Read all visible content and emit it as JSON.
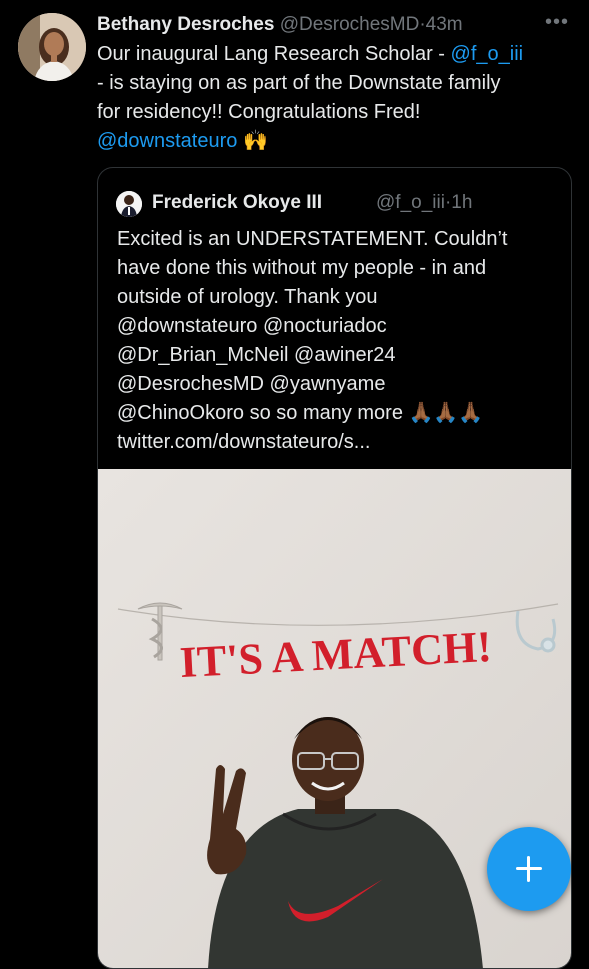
{
  "tweet": {
    "author_name": "Bethany Desroches",
    "author_handle": "@DesrochesMD",
    "separator": "·",
    "time": "43m",
    "more_label": "•••",
    "text_line1_a": "Our inaugural Lang Research Scholar - ",
    "text_line1_mention": "@f_o_iii",
    "text_line2": "- is staying on as part of the Downstate family",
    "text_line3": "for residency!! Congratulations Fred!",
    "text_line4_mention": "@downstateuro",
    "text_line4_emoji": "🙌"
  },
  "quote": {
    "author_name": "Frederick Okoye III",
    "author_handle": "@f_o_iii",
    "separator": "·",
    "time": "1h",
    "lines": [
      "Excited is an UNDERSTATEMENT. Couldn’t",
      "have done this without my people - in and",
      "outside of urology. Thank you",
      "@downstateuro @nocturiadoc",
      "@Dr_Brian_McNeil @awiner24",
      "@DesrochesMD @yawnyame",
      "@ChinoOkoro so so many more 🙏🏾🙏🏾🙏🏾",
      "twitter.com/downstateuro/s..."
    ],
    "banner_text": "IT'S A MATCH!"
  },
  "compose_button": {
    "icon": "plus-icon"
  },
  "colors": {
    "accent": "#1d9bf0",
    "text": "#e7e9ea",
    "muted": "#71767b",
    "border": "#2f3336",
    "banner": "#d21f2b"
  }
}
